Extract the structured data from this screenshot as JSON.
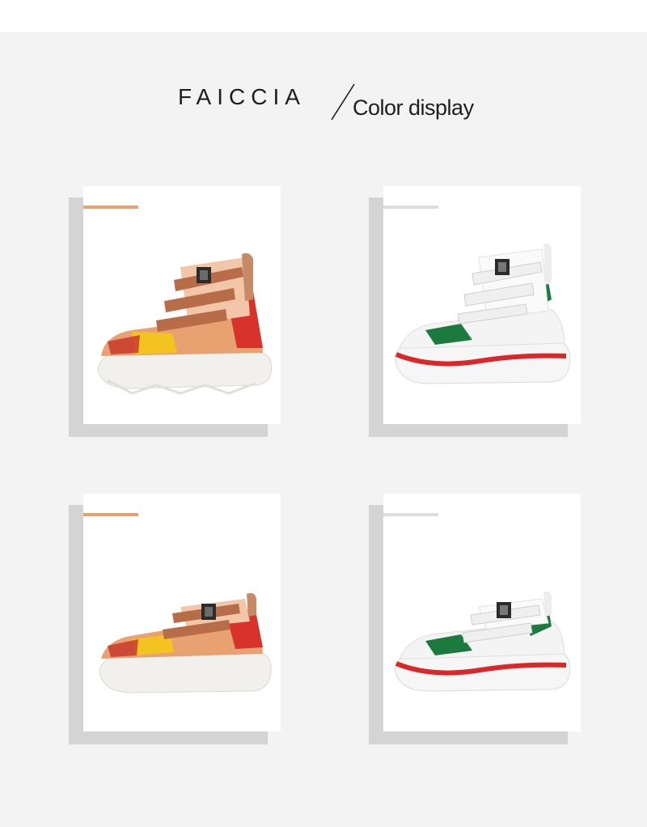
{
  "header": {
    "brand": "FAICCIA",
    "subtitle": "Color display"
  },
  "colors": {
    "accent_orange": "#e8a06c",
    "accent_light": "#dedede",
    "background": "#f3f3f3",
    "card_shadow": "#d4d4d4"
  },
  "cards": [
    {
      "image": "orange-multicolor-high-top-sneaker",
      "accent": "#e8a06c"
    },
    {
      "image": "white-green-red-high-top-sneaker",
      "accent": "#dedede"
    },
    {
      "image": "orange-multicolor-low-top-sneaker",
      "accent": "#e8a06c"
    },
    {
      "image": "white-green-red-low-top-sneaker",
      "accent": "#dedede"
    }
  ]
}
